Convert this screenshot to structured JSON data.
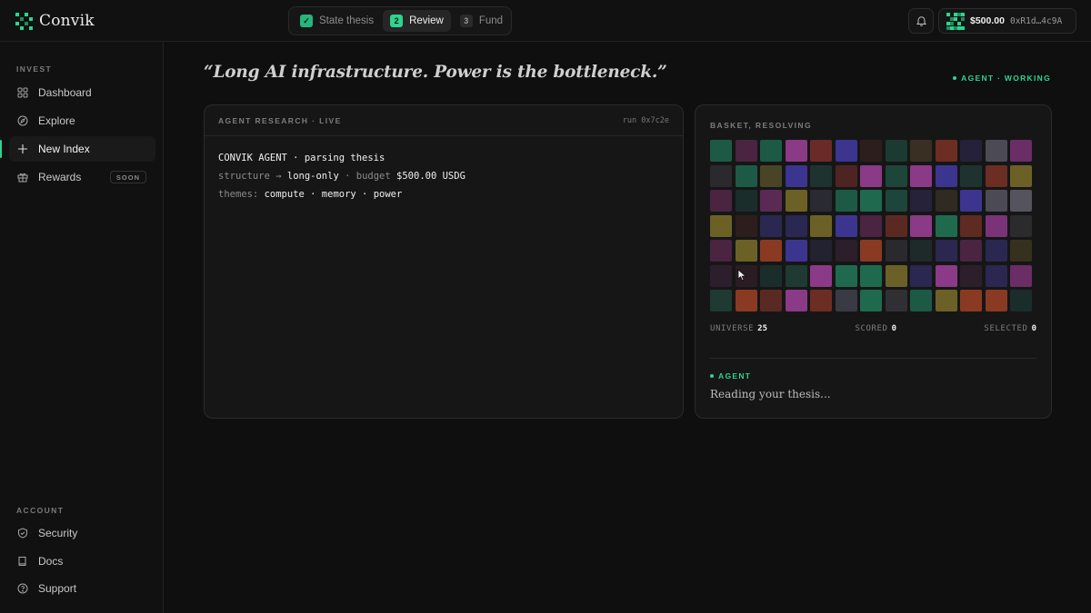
{
  "app": {
    "name": "Convik",
    "colors": {
      "accent": "#2fd38f",
      "background": "#0f0f0f",
      "panel": "#161616"
    }
  },
  "stepper": {
    "steps": [
      {
        "num": "✓",
        "label": "State thesis",
        "state": "done"
      },
      {
        "num": "2",
        "label": "Review",
        "state": "active"
      },
      {
        "num": "3",
        "label": "Fund",
        "state": "pending"
      }
    ]
  },
  "wallet": {
    "balance": "$500.00",
    "address": "0xR1d…4c9A"
  },
  "sidebar": {
    "invest_label": "INVEST",
    "invest_items": [
      {
        "label": "Dashboard",
        "icon": "grid-icon"
      },
      {
        "label": "Explore",
        "icon": "compass-icon"
      },
      {
        "label": "New Index",
        "icon": "plus-icon",
        "active": true
      },
      {
        "label": "Rewards",
        "icon": "gift-icon",
        "badge": "SOON"
      }
    ],
    "account_label": "ACCOUNT",
    "account_items": [
      {
        "label": "Security",
        "icon": "shield-icon"
      },
      {
        "label": "Docs",
        "icon": "book-icon"
      },
      {
        "label": "Support",
        "icon": "help-circle-icon"
      }
    ]
  },
  "main": {
    "thesis": "“Long AI infrastructure. Power is the bottleneck.”",
    "agent_status": "AGENT · WORKING",
    "research": {
      "title": "AGENT RESEARCH · LIVE",
      "run_id": "run 0x7c2e",
      "line1": "CONVIK AGENT · parsing thesis",
      "line2_key": "structure →",
      "line2_value": "long-only",
      "line2_sep": "·",
      "line2_key2": "budget",
      "line2_value2": "$500.00 USDG",
      "line3_key": "themes:",
      "line3_value": "compute · memory · power"
    },
    "basket": {
      "title": "BASKET, RESOLVING",
      "tile_colors": [
        "#1d5a45",
        "#4a2440",
        "#1c5a45",
        "#8a3a86",
        "#6a2a27",
        "#3c3590",
        "#2d1e1e",
        "#1b3a31",
        "#3a2f23",
        "#6c2d22",
        "#25213a",
        "#4c4b55",
        "#6a2d66",
        "#2a2a2e",
        "#1d5a45",
        "#4a4427",
        "#3c3590",
        "#1e3330",
        "#4e2423",
        "#8a3a86",
        "#1d4539",
        "#8a3a86",
        "#3c3590",
        "#1e3330",
        "#6c2d22",
        "#6b6126",
        "#4a2440",
        "#1b2d2b",
        "#5a2a55",
        "#6b6126",
        "#2a2a32",
        "#1d5a45",
        "#1f6a4e",
        "#1d4539",
        "#26223a",
        "#2f2a22",
        "#3c3590",
        "#4c4b55",
        "#55545e",
        "#6b6126",
        "#2d1e1e",
        "#2a2850",
        "#2a2850",
        "#6b6126",
        "#3c3590",
        "#4a2440",
        "#5a2a22",
        "#8a3a86",
        "#1f6a4e",
        "#5e2a22",
        "#7a3278",
        "#2b2b2e",
        "#4a2440",
        "#6b6126",
        "#8a3a22",
        "#3c3590",
        "#222230",
        "#2d1e2b",
        "#8a3a22",
        "#2a2a2e",
        "#1e2a2a",
        "#2a2850",
        "#4a2440",
        "#2a2850",
        "#36301e",
        "#2d1e2b",
        "#2a1c22",
        "#1b2d2b",
        "#1e3a32",
        "#8a3a86",
        "#1f6a4e",
        "#1f6a4e",
        "#6b6126",
        "#2a2850",
        "#8a3a86",
        "#2d1e2b",
        "#2a2850",
        "#6a2d66",
        "#1e3a32",
        "#8a3a22",
        "#5a2a22",
        "#8a3a86",
        "#6c2d22",
        "#3a3a44",
        "#1f6a4e",
        "#2f2f35",
        "#1d5a45",
        "#6b6126",
        "#8a3a22",
        "#8a3a22",
        "#1b2d2b"
      ],
      "stats": {
        "universe_label": "UNIVERSE",
        "universe": "25",
        "scored_label": "SCORED",
        "scored": "0",
        "selected_label": "SELECTED",
        "selected": "0"
      },
      "agent_label": "AGENT",
      "agent_message": "Reading your thesis..."
    }
  }
}
